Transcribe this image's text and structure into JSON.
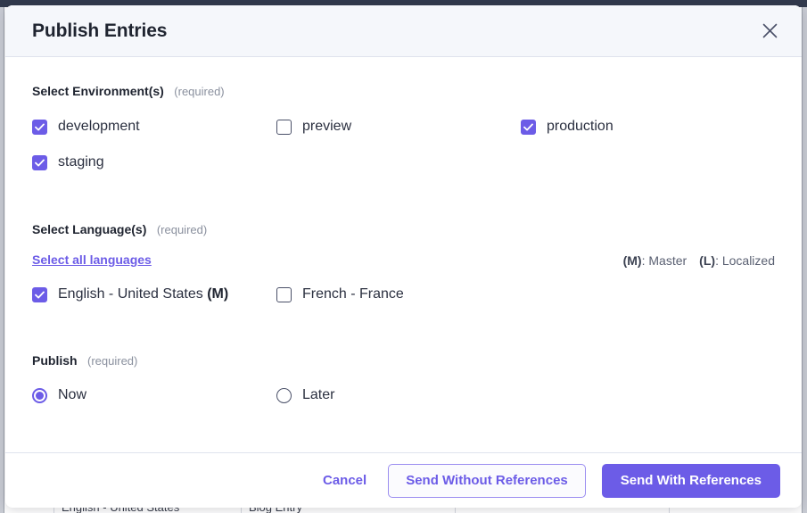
{
  "background": {
    "table_row": [
      "",
      "English - United States",
      "Blog Entry",
      "",
      ""
    ]
  },
  "modal": {
    "title": "Publish Entries",
    "close_icon": "close-icon",
    "environment_section": {
      "label": "Select Environment(s)",
      "required": "(required)",
      "options": [
        {
          "label": "development",
          "checked": true
        },
        {
          "label": "preview",
          "checked": false
        },
        {
          "label": "production",
          "checked": true
        },
        {
          "label": "staging",
          "checked": true
        }
      ]
    },
    "language_section": {
      "label": "Select Language(s)",
      "required": "(required)",
      "select_all_link": "Select all languages",
      "legend": {
        "master_key": "(M)",
        "master_text": ": Master",
        "localized_key": "(L)",
        "localized_text": ": Localized"
      },
      "options": [
        {
          "label": "English - United States",
          "suffix": "(M)",
          "checked": true
        },
        {
          "label": "French - France",
          "suffix": "",
          "checked": false
        }
      ]
    },
    "publish_section": {
      "label": "Publish",
      "required": "(required)",
      "options": [
        {
          "label": "Now",
          "selected": true
        },
        {
          "label": "Later",
          "selected": false
        }
      ]
    },
    "footer": {
      "cancel_label": "Cancel",
      "send_without_refs_label": "Send Without References",
      "send_with_refs_label": "Send With References"
    }
  },
  "colors": {
    "accent": "#6c5ce7",
    "header_bg": "#f5f7fb",
    "text": "#1f2430",
    "muted": "#8a909e",
    "topbar": "#323a4d"
  }
}
